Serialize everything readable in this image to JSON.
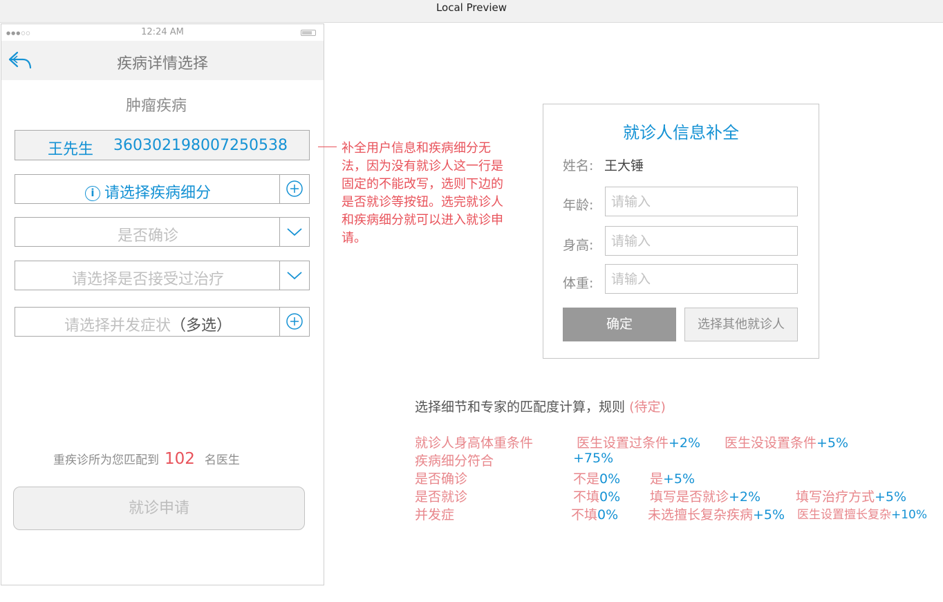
{
  "window": {
    "title": "Local Preview"
  },
  "status_bar": {
    "signal": "●●●○○",
    "time": "12:24 AM"
  },
  "nav": {
    "title": "疾病详情选择"
  },
  "section": {
    "title": "肿瘤疾病"
  },
  "patient": {
    "name": "王先生",
    "id": "360302198007250538"
  },
  "fields": {
    "disease_detail": "请选择疾病细分",
    "diagnosed": "是否确诊",
    "treatment": "请选择是否接受过治疗",
    "complication_placeholder": "请选择并发症状",
    "complication_suffix": "（多选）"
  },
  "match": {
    "prefix": "重疾诊所为您匹配到",
    "count": "102",
    "suffix": "名医生"
  },
  "apply_button": "就诊申请",
  "annotation": "补全用户信息和疾病细分无法，因为没有就诊人这一行是固定的不能改写，选则下边的是否就诊等按钮。选完就诊人和疾病细分就可以进入就诊申请。",
  "dialog": {
    "title": "就诊人信息补全",
    "name_label": "姓名:",
    "name_value": "王大锤",
    "age_label": "年龄:",
    "height_label": "身高:",
    "weight_label": "体重:",
    "input_placeholder": "请输入",
    "ok_button": "确定",
    "other_button": "选择其他就诊人"
  },
  "rules": {
    "title": "选择细节和专家的匹配度计算，规则",
    "title_note": "(待定)",
    "rows": [
      {
        "label": "就诊人身高体重条件",
        "c1_text": "医生设置过条件",
        "c1_val": "+2%",
        "c2_text": "医生没设置条件",
        "c2_val": "+5%"
      },
      {
        "label": "疾病细分符合",
        "c1_text": "",
        "c1_val": "+75%"
      },
      {
        "label": "是否确诊",
        "c1_text": "不是",
        "c1_val": "0%",
        "c2_text": "是",
        "c2_val": "+5%"
      },
      {
        "label": "是否就诊",
        "c1_text": "不填",
        "c1_val": "0%",
        "c2_text": "填写是否就诊",
        "c2_val": "+2%",
        "c3_text": "填写治疗方式",
        "c3_val": "+5%"
      },
      {
        "label": "并发症",
        "c1_text": "不填",
        "c1_val": "0%",
        "c2_text": "未选擅长复杂疾病",
        "c2_val": "+5%",
        "c3_text": "医生设置擅长复杂",
        "c3_val": "+10%"
      }
    ]
  },
  "colors": {
    "accent": "#1592d4",
    "alert": "#e8525a",
    "note": "#e8878c"
  }
}
